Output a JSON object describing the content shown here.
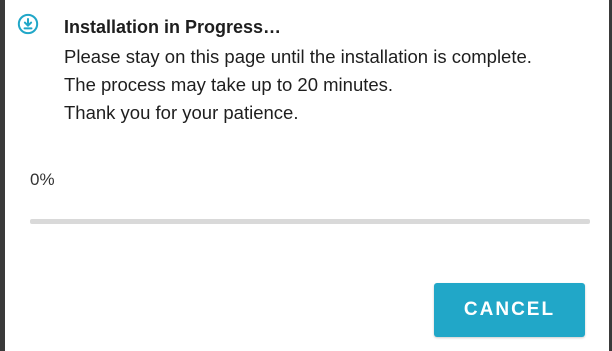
{
  "dialog": {
    "icon": "download-circle-icon",
    "title": "Installation in Progress…",
    "message_lines": [
      "Please stay on this page until the installation is complete.",
      "The process may take up to 20 minutes.",
      "Thank you for your patience."
    ],
    "progress": {
      "label": "0%",
      "value_percent": 0
    },
    "cancel_label": "CANCEL"
  },
  "colors": {
    "accent": "#21a7c8",
    "track": "#d9d9d9",
    "text": "#1e1e1e",
    "backdrop": "#3a3a3a"
  }
}
